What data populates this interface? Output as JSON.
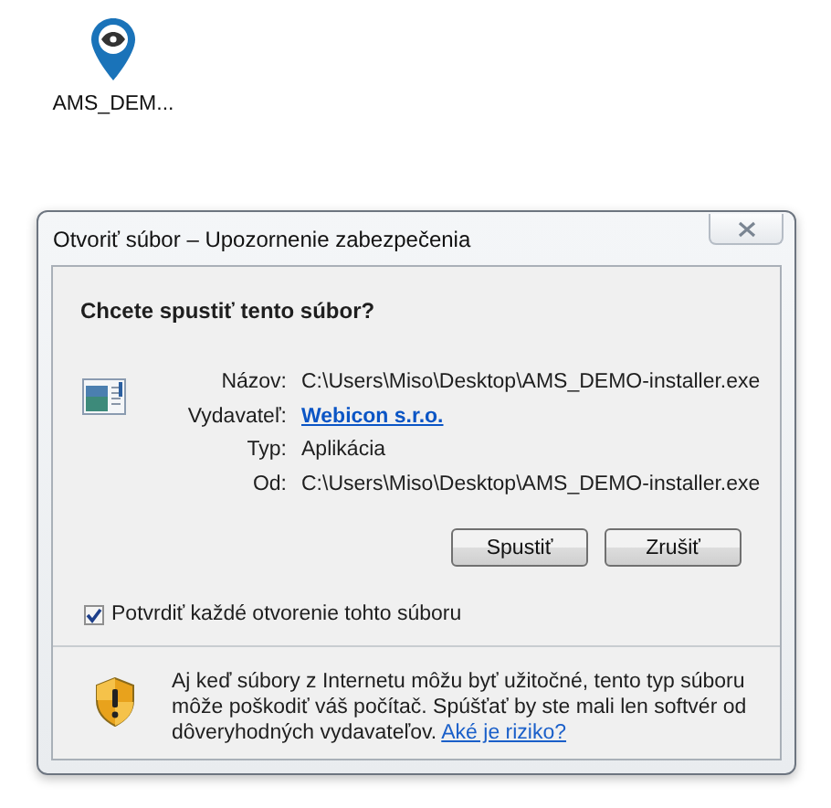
{
  "desktop_icon": {
    "label": "AMS_DEM..."
  },
  "dialog": {
    "title": "Otvoriť súbor – Upozornenie zabezpečenia",
    "heading": "Chcete spustiť tento súbor?",
    "fields": [
      {
        "label": "Názov:",
        "value": "C:\\Users\\Miso\\Desktop\\AMS_DEMO-installer.exe",
        "kind": "text"
      },
      {
        "label": "Vydavateľ:",
        "value": "Webicon s.r.o.",
        "kind": "link"
      },
      {
        "label": "Typ:",
        "value": "Aplikácia",
        "kind": "text"
      },
      {
        "label": "Od:",
        "value": "C:\\Users\\Miso\\Desktop\\AMS_DEMO-installer.exe",
        "kind": "text"
      }
    ],
    "buttons": [
      "Spustiť",
      "Zrušiť"
    ],
    "confirm_checkbox": {
      "label": "Potvrdiť každé otvorenie tohto súboru",
      "checked": true
    },
    "warning": {
      "text": "Aj keď súbory z Internetu môžu byť užitočné, tento typ súboru môže poškodiť váš počítač. Spúšťať by ste mali len softvér od dôveryhodných vydavateľov.",
      "link": "Aké je riziko?"
    }
  }
}
